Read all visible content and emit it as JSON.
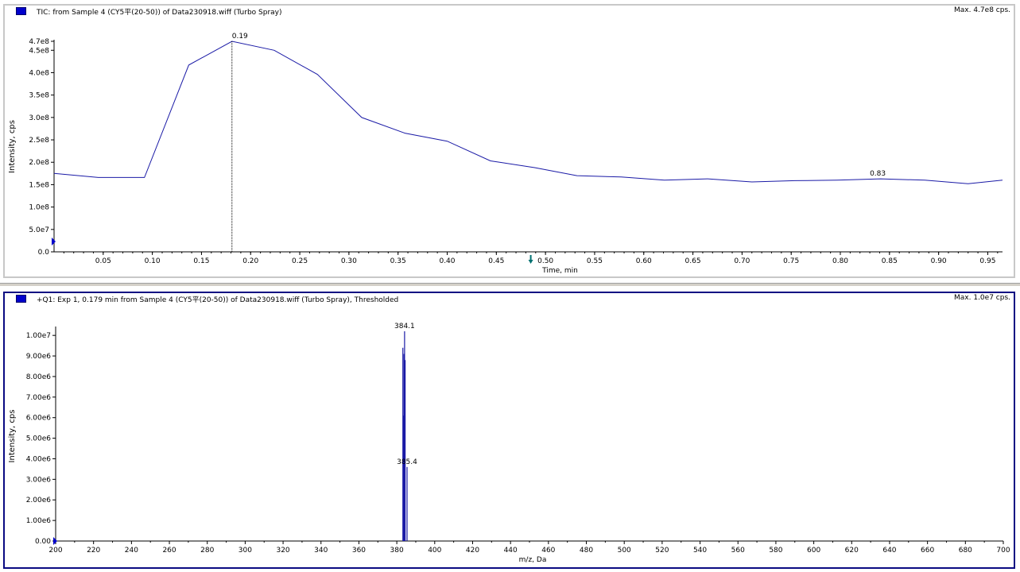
{
  "tic_panel": {
    "title": "TIC: from Sample 4 (CY5平(20-50)) of Data230918.wiff (Turbo Spray)",
    "max_label": "Max. 4.7e8 cps.",
    "icon": "chromatogram-icon"
  },
  "ms_panel": {
    "title": "+Q1: Exp 1, 0.179 min from Sample 4 (CY5平(20-50)) of Data230918.wiff (Turbo Spray), Thresholded",
    "max_label": "Max. 1.0e7 cps.",
    "icon": "spectrum-icon"
  },
  "colors": {
    "trace": "#1a1aa6",
    "marker": "#0000cc",
    "axis": "#000000",
    "cursor_arrow": "#007070"
  },
  "chart_data": [
    {
      "type": "line",
      "xlabel": "Time, min",
      "ylabel": "Intensity, cps",
      "xlim": [
        0,
        0.965
      ],
      "ylim": [
        0,
        470000000
      ],
      "x_ticks": [
        0.05,
        0.1,
        0.15,
        0.2,
        0.25,
        0.3,
        0.35,
        0.4,
        0.45,
        0.5,
        0.55,
        0.6,
        0.65,
        0.7,
        0.75,
        0.8,
        0.85,
        0.9,
        0.95
      ],
      "x_tick_labels": [
        "0.05",
        "0.10",
        "0.15",
        "0.20",
        "0.25",
        "0.30",
        "0.35",
        "0.40",
        "0.45",
        "0.50",
        "0.55",
        "0.60",
        "0.65",
        "0.70",
        "0.75",
        "0.80",
        "0.85",
        "0.90",
        "0.95"
      ],
      "y_ticks": [
        0,
        50000000,
        100000000,
        150000000,
        200000000,
        250000000,
        300000000,
        350000000,
        400000000,
        450000000,
        470000000
      ],
      "y_tick_labels": [
        "0.0",
        "5.0e7",
        "1.0e8",
        "1.5e8",
        "2.0e8",
        "2.5e8",
        "3.0e8",
        "3.5e8",
        "4.0e8",
        "4.5e8",
        "4.7e8"
      ],
      "series": [
        {
          "x": [
            0.0,
            0.045,
            0.092,
            0.137,
            0.181,
            0.224,
            0.268,
            0.313,
            0.357,
            0.4,
            0.444,
            0.489,
            0.532,
            0.577,
            0.621,
            0.665,
            0.71,
            0.754,
            0.797,
            0.841,
            0.886,
            0.93,
            0.965
          ],
          "y": [
            175000000,
            166000000,
            166000000,
            417000000,
            470000000,
            450000000,
            396000000,
            300000000,
            265000000,
            247000000,
            203000000,
            188000000,
            170000000,
            167000000,
            160000000,
            163000000,
            156000000,
            159000000,
            160000000,
            163000000,
            160000000,
            152000000,
            160000000
          ]
        }
      ],
      "annotations": [
        {
          "x": 0.181,
          "y": 470000000,
          "text": "0.19"
        },
        {
          "x": 0.83,
          "y": 163000000,
          "text": "0.83"
        }
      ],
      "cursor_x": 0.181,
      "cursor_arrow_x": 0.485
    },
    {
      "type": "bar",
      "xlabel": "m/z, Da",
      "ylabel": "Intensity, cps",
      "xlim": [
        200,
        700
      ],
      "ylim": [
        0,
        10200000
      ],
      "x_ticks": [
        200,
        220,
        240,
        260,
        280,
        300,
        320,
        340,
        360,
        380,
        400,
        420,
        440,
        460,
        480,
        500,
        520,
        540,
        560,
        580,
        600,
        620,
        640,
        660,
        680,
        700
      ],
      "x_tick_labels": [
        "200",
        "220",
        "240",
        "260",
        "280",
        "300",
        "320",
        "340",
        "360",
        "380",
        "400",
        "420",
        "440",
        "460",
        "480",
        "500",
        "520",
        "540",
        "560",
        "580",
        "600",
        "620",
        "640",
        "660",
        "680",
        "700"
      ],
      "y_ticks": [
        0,
        1000000,
        2000000,
        3000000,
        4000000,
        5000000,
        6000000,
        7000000,
        8000000,
        9000000,
        10000000
      ],
      "y_tick_labels": [
        "0.00",
        "1.00e6",
        "2.00e6",
        "3.00e6",
        "4.00e6",
        "5.00e6",
        "6.00e6",
        "7.00e6",
        "8.00e6",
        "9.00e6",
        "1.00e7"
      ],
      "peaks": [
        {
          "mz": 383.2,
          "intensity": 9400000
        },
        {
          "mz": 383.5,
          "intensity": 6100000
        },
        {
          "mz": 383.8,
          "intensity": 9100000
        },
        {
          "mz": 384.1,
          "intensity": 10200000
        },
        {
          "mz": 384.4,
          "intensity": 8800000
        },
        {
          "mz": 385.4,
          "intensity": 3600000
        }
      ],
      "annotations": [
        {
          "x": 384.1,
          "y": 10200000,
          "text": "384.1"
        },
        {
          "x": 385.4,
          "y": 3600000,
          "text": "385.4"
        }
      ]
    }
  ]
}
